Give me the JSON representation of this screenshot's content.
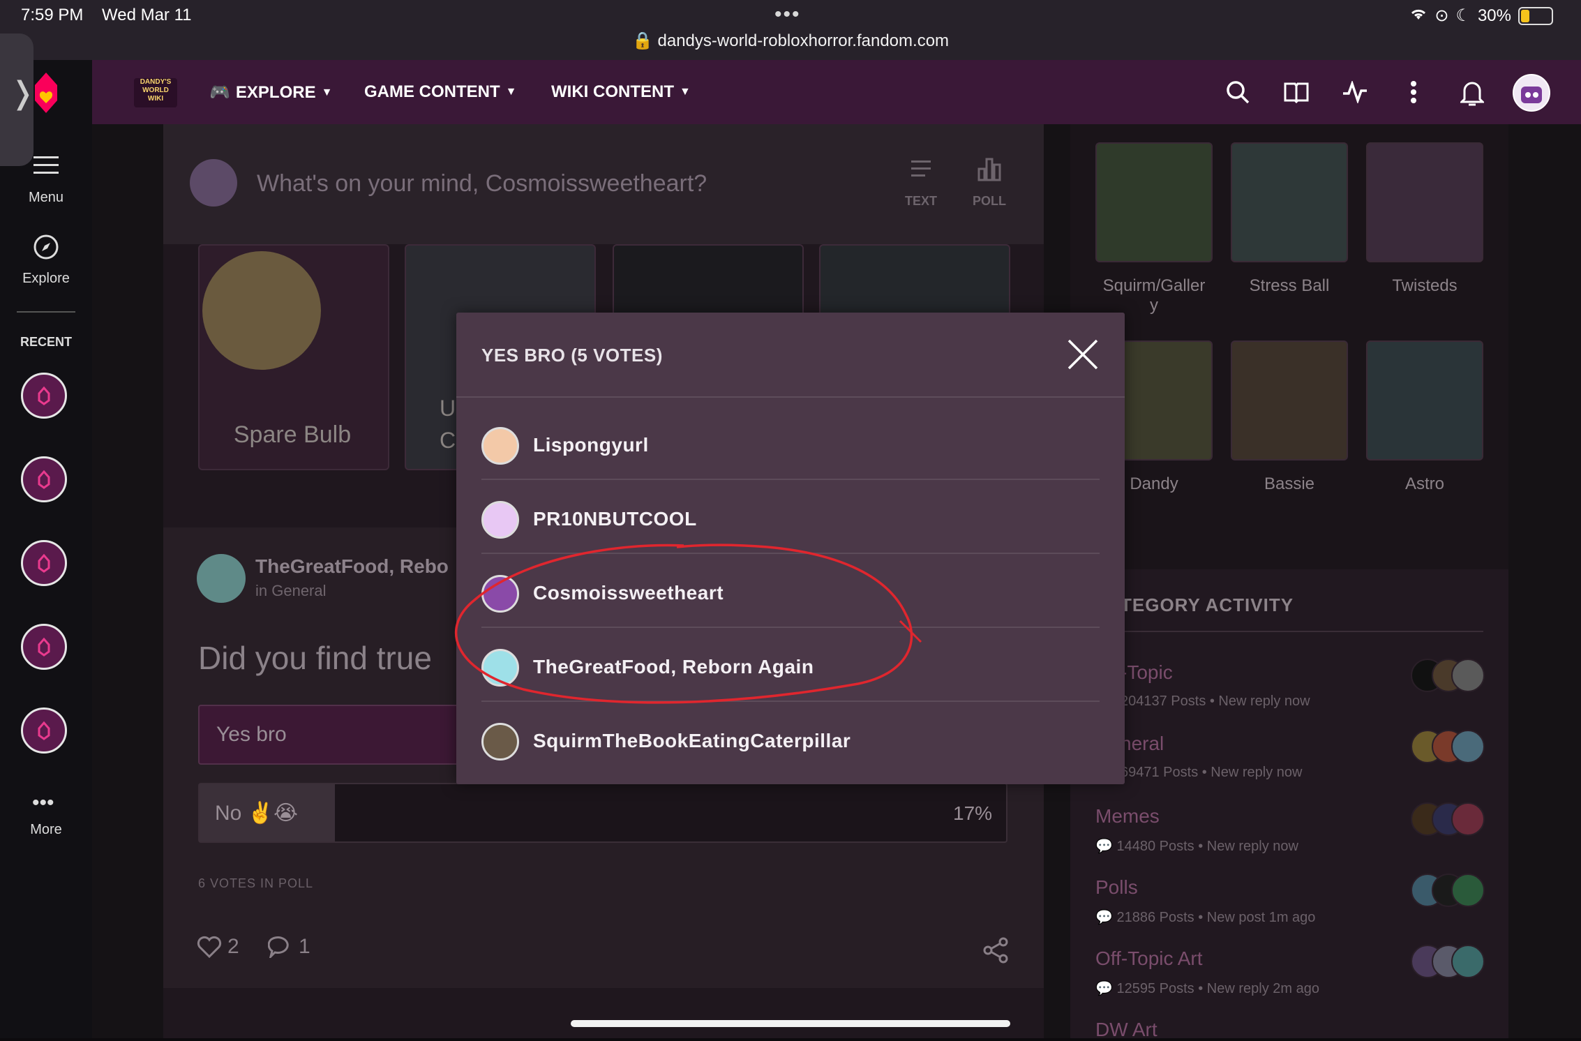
{
  "status_bar": {
    "time": "7:59 PM",
    "date": "Wed Mar 11",
    "url": "dandys-world-robloxhorror.fandom.com",
    "battery": "30%",
    "battery_level": 0.3
  },
  "left_rail": {
    "menu_label": "Menu",
    "explore_label": "Explore",
    "recent_label": "RECENT",
    "more_label": "More"
  },
  "top_nav": {
    "logo_text": "DANDY'S WORLD WIKI",
    "items": [
      {
        "label": "EXPLORE"
      },
      {
        "label": "GAME CONTENT"
      },
      {
        "label": "WIKI CONTENT"
      }
    ]
  },
  "post_box": {
    "placeholder": "What's on your mind, Cosmoissweetheart?",
    "text_label": "TEXT",
    "poll_label": "POLL"
  },
  "cards": [
    {
      "label": "Spare Bulb"
    },
    {
      "label": "U\nC"
    }
  ],
  "poll_post": {
    "author": "TheGreatFood, Rebo",
    "category": "in General",
    "question": "Did you find true",
    "option1": "Yes bro",
    "option2": "No ✌️😭",
    "option2_pct": "17%",
    "votes_text": "6 VOTES IN POLL",
    "likes": "2",
    "comments": "1"
  },
  "right_sidebar": {
    "thumbs": [
      {
        "label": "Squirm/Galler\ny"
      },
      {
        "label": "Stress Ball"
      },
      {
        "label": "Twisteds"
      },
      {
        "label": "Dandy"
      },
      {
        "label": "Bassie"
      },
      {
        "label": "Astro"
      }
    ],
    "category_title": "TEGORY ACTIVITY",
    "categories": [
      {
        "name": "-Topic",
        "meta": "204137 Posts • New reply now"
      },
      {
        "name": "neral",
        "meta": "69471 Posts • New reply now"
      },
      {
        "name": "Memes",
        "meta": "14480 Posts • New reply now"
      },
      {
        "name": "Polls",
        "meta": "21886 Posts • New post 1m ago"
      },
      {
        "name": "Off-Topic Art",
        "meta": "12595 Posts • New reply 2m ago"
      },
      {
        "name": "DW Art",
        "meta": ""
      }
    ]
  },
  "modal": {
    "title": "YES BRO (5 VOTES)",
    "voters": [
      {
        "name": "Lispongyurl"
      },
      {
        "name": "PR10NBUTCOOL"
      },
      {
        "name": "Cosmoissweetheart"
      },
      {
        "name": "TheGreatFood, Reborn Again"
      },
      {
        "name": "SquirmTheBookEatingCaterpillar"
      }
    ]
  },
  "colors": {
    "nav_bg": "#3a1837",
    "modal_bg": "#4b3848",
    "annotation": "#e0262e"
  }
}
